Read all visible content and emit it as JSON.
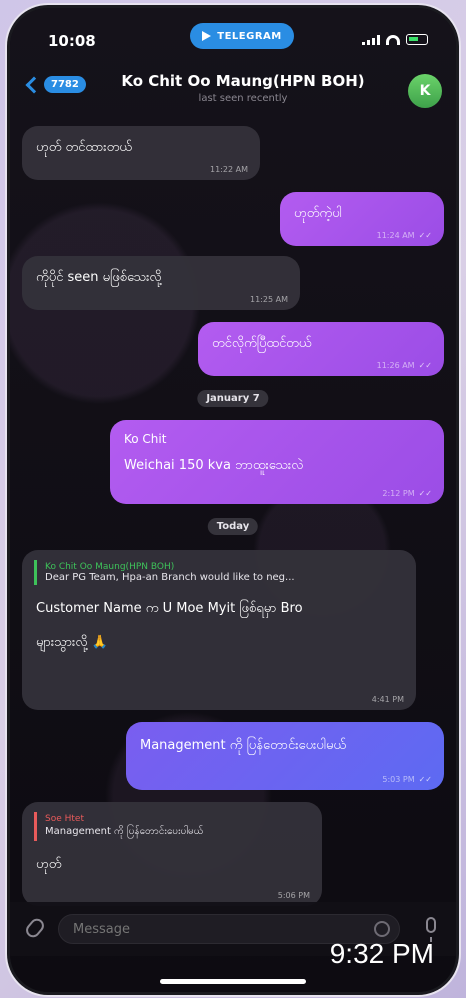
{
  "status_bar": {
    "time": "10:08",
    "app_pill": "TELEGRAM"
  },
  "header": {
    "back_badge": "7782",
    "title": "Ko Chit Oo Maung(HPN BOH)",
    "subtitle": "last seen recently",
    "avatar_letter": "K"
  },
  "messages": [
    {
      "dir": "in",
      "text": "ဟုတ် တင်ထားတယ်",
      "time": "11:22 AM"
    },
    {
      "dir": "out",
      "text": "ဟုတ်ကဲ့ပါ",
      "time": "11:24 AM"
    },
    {
      "dir": "in",
      "text": "ကိုပိုင် seen မဖြစ်သေးလို့",
      "time": "11:25 AM"
    },
    {
      "dir": "out",
      "text": "တင်လိုက်ပြီထင်တယ်",
      "time": "11:26 AM"
    },
    {
      "dir": "out",
      "sender": "Ko Chit",
      "text": "Weichai 150 kva ဘာထူးသေးလဲ",
      "time": "2:12 PM"
    },
    {
      "dir": "in",
      "reply_name": "Ko Chit Oo Maung(HPN BOH)",
      "reply_text": "Dear PG Team, Hpa-an Branch would like to neg...",
      "text_line1": "Customer Name က U Moe Myit ဖြစ်ရမှာ Bro",
      "text_line2": "များသွားလို့ 🙏",
      "time": "4:41 PM"
    },
    {
      "dir": "out",
      "text": "Management ကို ပြန်တောင်းပေးပါမယ်",
      "time": "5:03 PM"
    },
    {
      "dir": "in",
      "reply_name": "Soe Htet",
      "reply_text": "Management ကို ပြန်တောင်းပေးပါမယ်",
      "text": "ဟုတ်",
      "time": "5:06 PM"
    }
  ],
  "dates": {
    "d1": "January 7",
    "d2": "Today"
  },
  "input": {
    "placeholder": "Message"
  },
  "overlay_time": "9:32 PM",
  "colors": {
    "accent": "#2a8de3",
    "outgoing": "#b35cf0",
    "outgoing_blue": "#6066f0",
    "incoming": "#34323a"
  }
}
